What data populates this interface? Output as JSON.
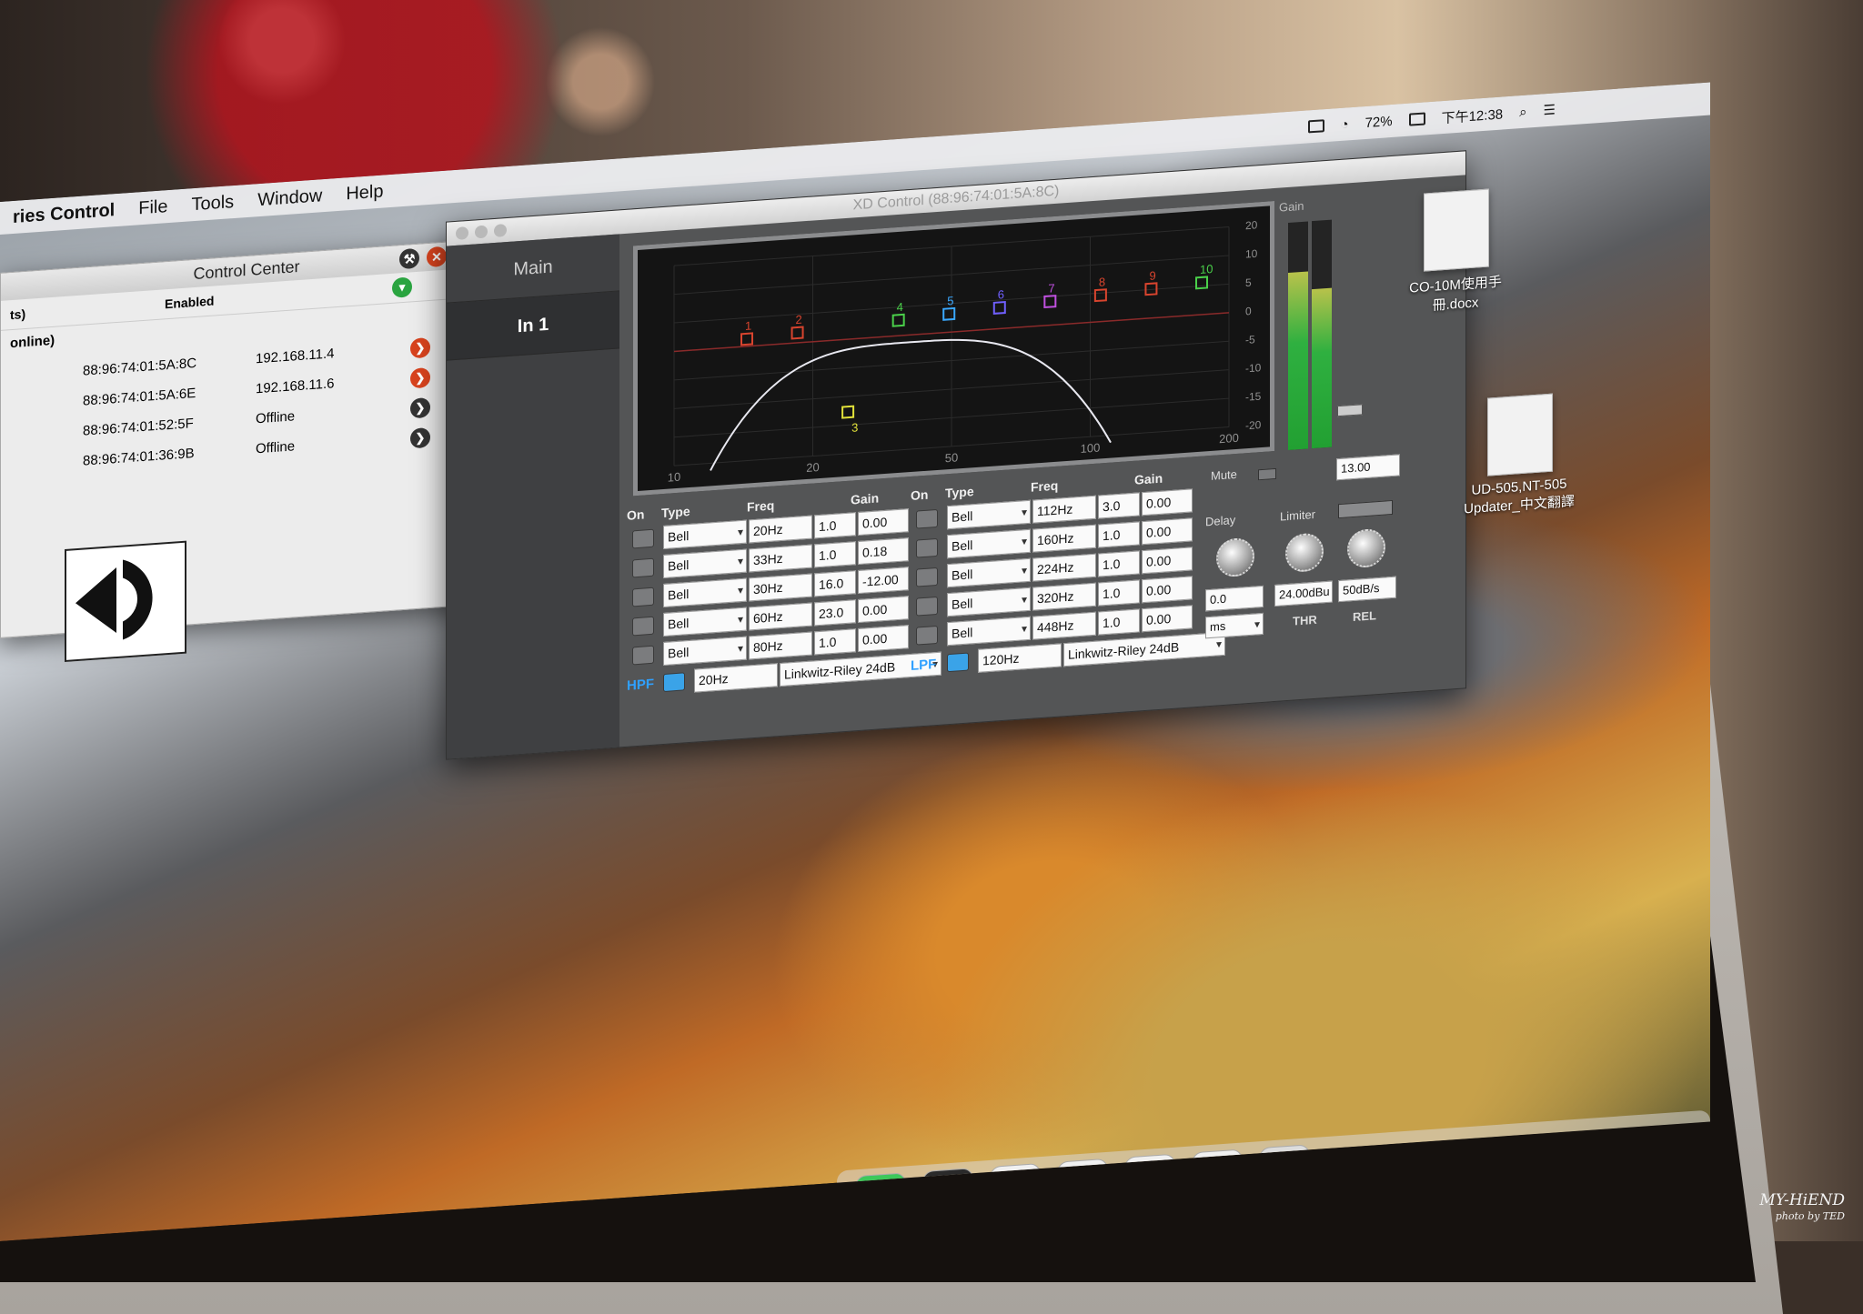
{
  "menubar": {
    "app_name": "ries Control",
    "items": [
      "File",
      "Tools",
      "Window",
      "Help"
    ],
    "status_battery": "72%",
    "status_clock": "下午12:38"
  },
  "control_center": {
    "title": "Control Center",
    "header_col1": "ts)",
    "header_col2": "Enabled",
    "group_label": "online)",
    "devices": [
      {
        "mac": "88:96:74:01:5A:8C",
        "ip": "192.168.11.4",
        "status_color": "#d8431e"
      },
      {
        "mac": "88:96:74:01:5A:6E",
        "ip": "192.168.11.6",
        "status_color": "#d8431e"
      },
      {
        "mac": "88:96:74:01:52:5F",
        "ip": "Offline",
        "status_color": "#333333"
      },
      {
        "mac": "88:96:74:01:36:9B",
        "ip": "Offline",
        "status_color": "#333333"
      }
    ]
  },
  "xd_window": {
    "title": "XD Control (88:96:74:01:5A:8C)",
    "tabs": [
      "Main",
      "In 1"
    ]
  },
  "graph": {
    "x_ticks": [
      "10",
      "20",
      "50",
      "100",
      "200"
    ],
    "y_ticks": [
      "20",
      "10",
      "5",
      "0",
      "-5",
      "-10",
      "-15",
      "-20"
    ],
    "band_markers": [
      {
        "label": "1",
        "color": "#d8442e"
      },
      {
        "label": "2",
        "color": "#d8442e"
      },
      {
        "label": "3",
        "color": "#e2e23a"
      },
      {
        "label": "4",
        "color": "#4ad04a"
      },
      {
        "label": "5",
        "color": "#3aa8ff"
      },
      {
        "label": "6",
        "color": "#7060ff"
      },
      {
        "label": "7",
        "color": "#c050e0"
      },
      {
        "label": "8",
        "color": "#d8442e"
      },
      {
        "label": "9",
        "color": "#d8442e"
      },
      {
        "label": "10",
        "color": "#4ad04a"
      }
    ]
  },
  "gain": {
    "label": "Gain",
    "meter_level": 0.78
  },
  "eq_left": {
    "headers": {
      "on": "On",
      "type": "Type",
      "freq": "Freq",
      "gain": "Gain"
    },
    "bands": [
      {
        "on": false,
        "type": "Bell",
        "freq": "20Hz",
        "q": "1.0",
        "gain": "0.00"
      },
      {
        "on": false,
        "type": "Bell",
        "freq": "33Hz",
        "q": "1.0",
        "gain": "0.18"
      },
      {
        "on": false,
        "type": "Bell",
        "freq": "30Hz",
        "q": "16.0",
        "gain": "-12.00"
      },
      {
        "on": false,
        "type": "Bell",
        "freq": "60Hz",
        "q": "23.0",
        "gain": "0.00"
      },
      {
        "on": false,
        "type": "Bell",
        "freq": "80Hz",
        "q": "1.0",
        "gain": "0.00"
      }
    ],
    "filter": {
      "label": "HPF",
      "freq": "20Hz",
      "type": "Linkwitz-Riley 24dB",
      "on": true
    }
  },
  "eq_right": {
    "headers": {
      "on": "On",
      "type": "Type",
      "freq": "Freq",
      "gain": "Gain"
    },
    "bands": [
      {
        "on": false,
        "type": "Bell",
        "freq": "112Hz",
        "q": "3.0",
        "gain": "0.00"
      },
      {
        "on": false,
        "type": "Bell",
        "freq": "160Hz",
        "q": "1.0",
        "gain": "0.00"
      },
      {
        "on": false,
        "type": "Bell",
        "freq": "224Hz",
        "q": "1.0",
        "gain": "0.00"
      },
      {
        "on": false,
        "type": "Bell",
        "freq": "320Hz",
        "q": "1.0",
        "gain": "0.00"
      },
      {
        "on": false,
        "type": "Bell",
        "freq": "448Hz",
        "q": "1.0",
        "gain": "0.00"
      }
    ],
    "filter": {
      "label": "LPF",
      "freq": "120Hz",
      "type": "Linkwitz-Riley 24dB",
      "on": true
    }
  },
  "dynamics": {
    "mute_label": "Mute",
    "gain_value": "13.00",
    "delay_label": "Delay",
    "limiter_label": "Limiter",
    "delay_value": "0.0",
    "delay_unit": "ms",
    "threshold_value": "24.00dBu",
    "threshold_label": "THR",
    "release_value": "50dB/s",
    "release_label": "REL"
  },
  "desktop": {
    "file1_label": "CO-10M使用手冊.docx",
    "file2_label": "UD-505,NT-505 Updater_中文翻譯"
  },
  "watermark": {
    "brand": "MY-HiEND",
    "credit": "photo by TED"
  }
}
